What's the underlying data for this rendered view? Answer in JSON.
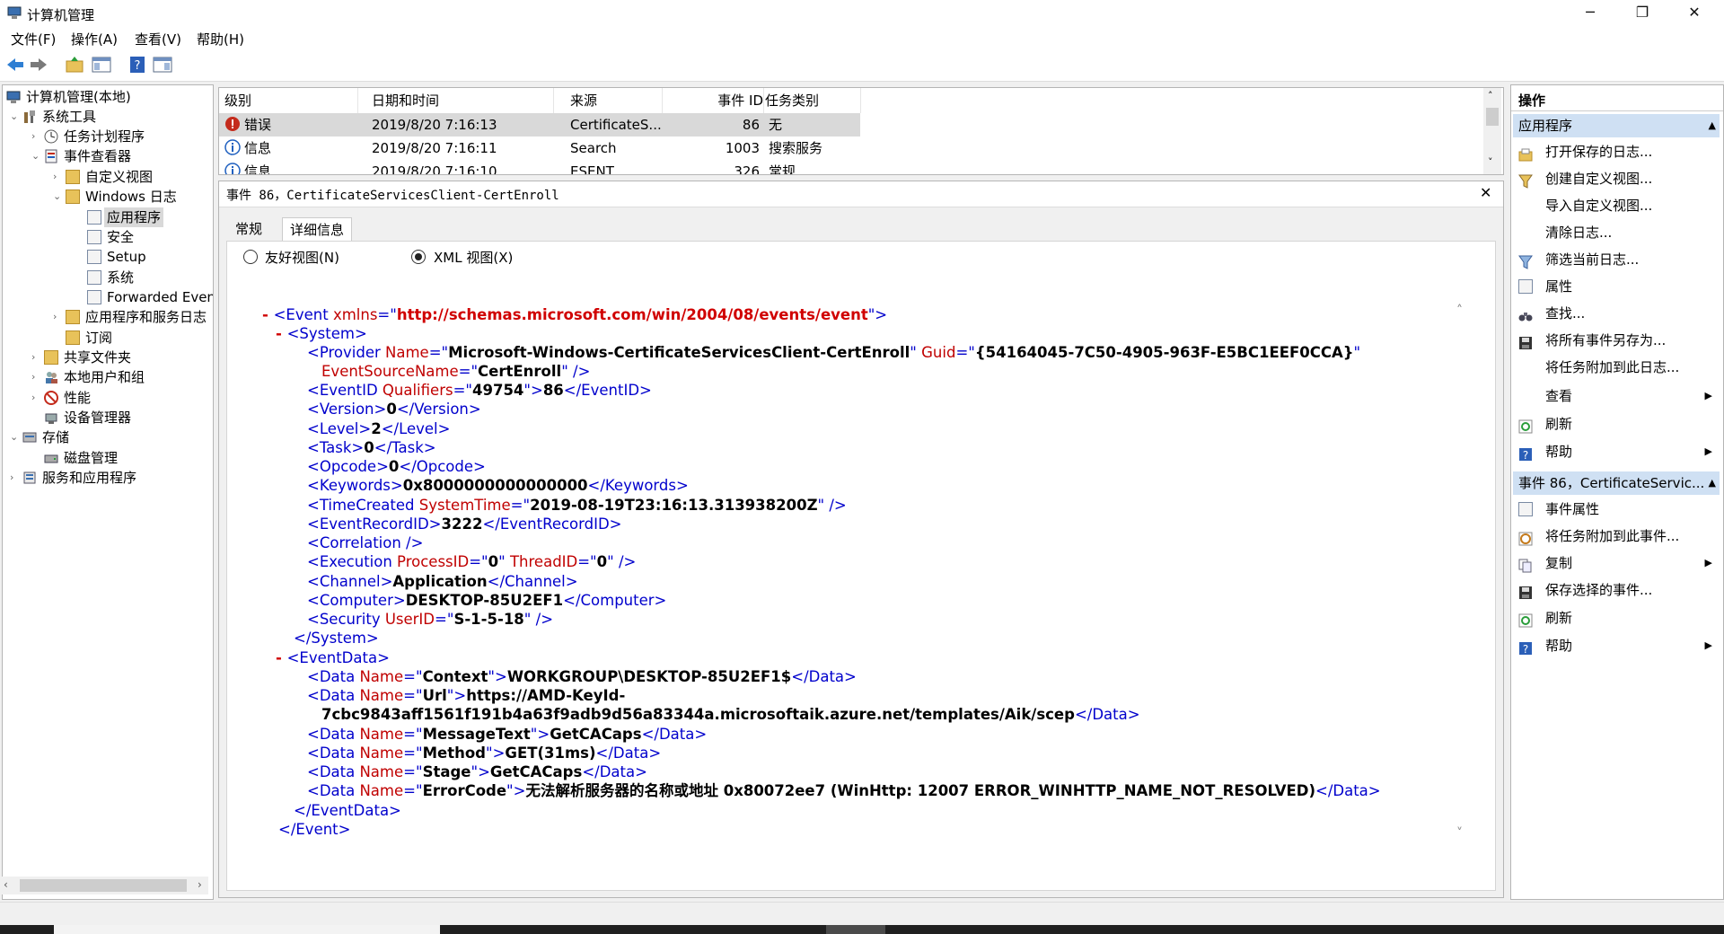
{
  "window": {
    "title": "计算机管理",
    "minimize": "─",
    "maximize": "❐",
    "close": "✕"
  },
  "menu": [
    "文件(F)",
    "操作(A)",
    "查看(V)",
    "帮助(H)"
  ],
  "tree": {
    "items": [
      {
        "label": "计算机管理(本地)",
        "expander": ""
      },
      {
        "label": "系统工具",
        "expander": "⌄"
      },
      {
        "label": "任务计划程序",
        "expander": "›"
      },
      {
        "label": "事件查看器",
        "expander": "⌄"
      },
      {
        "label": "自定义视图",
        "expander": "›"
      },
      {
        "label": "Windows 日志",
        "expander": "⌄"
      },
      {
        "label": "应用程序",
        "expander": ""
      },
      {
        "label": "安全",
        "expander": ""
      },
      {
        "label": "Setup",
        "expander": ""
      },
      {
        "label": "系统",
        "expander": ""
      },
      {
        "label": "Forwarded Even",
        "expander": ""
      },
      {
        "label": "应用程序和服务日志",
        "expander": "›"
      },
      {
        "label": "订阅",
        "expander": ""
      },
      {
        "label": "共享文件夹",
        "expander": "›"
      },
      {
        "label": "本地用户和组",
        "expander": "›"
      },
      {
        "label": "性能",
        "expander": "›"
      },
      {
        "label": "设备管理器",
        "expander": ""
      },
      {
        "label": "存储",
        "expander": "⌄"
      },
      {
        "label": "磁盘管理",
        "expander": ""
      },
      {
        "label": "服务和应用程序",
        "expander": "›"
      }
    ]
  },
  "event_list": {
    "headers": [
      "级别",
      "日期和时间",
      "来源",
      "事件 ID",
      "任务类别"
    ],
    "rows": [
      {
        "level": "错误",
        "datetime": "2019/8/20 7:16:13",
        "source": "CertificateS...",
        "id": "86",
        "category": "无"
      },
      {
        "level": "信息",
        "datetime": "2019/8/20 7:16:11",
        "source": "Search",
        "id": "1003",
        "category": "搜索服务"
      },
      {
        "level": "信息",
        "datetime": "2019/8/20 7:16:10",
        "source": "ESENT",
        "id": "326",
        "category": "常规"
      }
    ]
  },
  "detail": {
    "header": "事件 86，CertificateServicesClient-CertEnroll",
    "close": "✕",
    "tabs": [
      "常规",
      "详细信息"
    ],
    "radio_friendly": "友好视图(N)",
    "radio_xml": "XML 视图(X)"
  },
  "xml": {
    "ns_url": "http://schemas.microsoft.com/win/2004/08/events/event",
    "provider_name": "Microsoft-Windows-CertificateServicesClient-CertEnroll",
    "provider_guid": "{54164045-7C50-4905-963F-E5BC1EEF0CCA}",
    "event_source_name": "CertEnroll",
    "qualifiers": "49754",
    "event_id": "86",
    "version": "0",
    "level": "2",
    "task": "0",
    "opcode": "0",
    "keywords": "0x8000000000000000",
    "system_time": "2019-08-19T23:16:13.313938200Z",
    "record_id": "3222",
    "process_id": "0",
    "thread_id": "0",
    "channel": "Application",
    "computer": "DESKTOP-85U2EF1",
    "user_id": "S-1-5-18",
    "data_context": "WORKGROUP\\DESKTOP-85U2EF1$",
    "data_url_1": "https://AMD-KeyId-",
    "data_url_2": "7cbc9843aff1561f191b4a63f9adb9d56a83344a.microsoftaik.azure.net/templates/Aik/scep",
    "data_message": "GetCACaps",
    "data_method": "GET(31ms)",
    "data_stage": "GetCACaps",
    "data_error": "无法解析服务器的名称或地址  0x80072ee7 (WinHttp: 12007 ERROR_WINHTTP_NAME_NOT_RESOLVED)"
  },
  "actions": {
    "title": "操作",
    "section1": "应用程序",
    "items1": [
      {
        "label": "打开保存的日志...",
        "icon": "open-log-icon",
        "arrow": ""
      },
      {
        "label": "创建自定义视图...",
        "icon": "filter-icon",
        "arrow": ""
      },
      {
        "label": "导入自定义视图...",
        "icon": "",
        "arrow": ""
      },
      {
        "label": "清除日志...",
        "icon": "",
        "arrow": ""
      },
      {
        "label": "筛选当前日志...",
        "icon": "filter-icon",
        "arrow": ""
      },
      {
        "label": "属性",
        "icon": "properties-icon",
        "arrow": ""
      },
      {
        "label": "查找...",
        "icon": "binoculars-icon",
        "arrow": ""
      },
      {
        "label": "将所有事件另存为...",
        "icon": "save-icon",
        "arrow": ""
      },
      {
        "label": "将任务附加到此日志...",
        "icon": "",
        "arrow": ""
      },
      {
        "label": "查看",
        "icon": "",
        "arrow": "▶"
      },
      {
        "label": "刷新",
        "icon": "refresh-icon",
        "arrow": ""
      },
      {
        "label": "帮助",
        "icon": "help-icon",
        "arrow": "▶"
      }
    ],
    "section2": "事件 86，CertificateServic...",
    "items2": [
      {
        "label": "事件属性",
        "icon": "properties-icon",
        "arrow": ""
      },
      {
        "label": "将任务附加到此事件...",
        "icon": "task-icon",
        "arrow": ""
      },
      {
        "label": "复制",
        "icon": "copy-icon",
        "arrow": "▶"
      },
      {
        "label": "保存选择的事件...",
        "icon": "save-icon",
        "arrow": ""
      },
      {
        "label": "刷新",
        "icon": "refresh-icon",
        "arrow": ""
      },
      {
        "label": "帮助",
        "icon": "help-icon",
        "arrow": "▶"
      }
    ]
  },
  "colors": {
    "xml_tag": "#0000cc",
    "xml_attr": "#c00000",
    "section_bg": "#cfe0f3",
    "error_red": "#c42b1c",
    "info_blue": "#1e5fbf"
  }
}
